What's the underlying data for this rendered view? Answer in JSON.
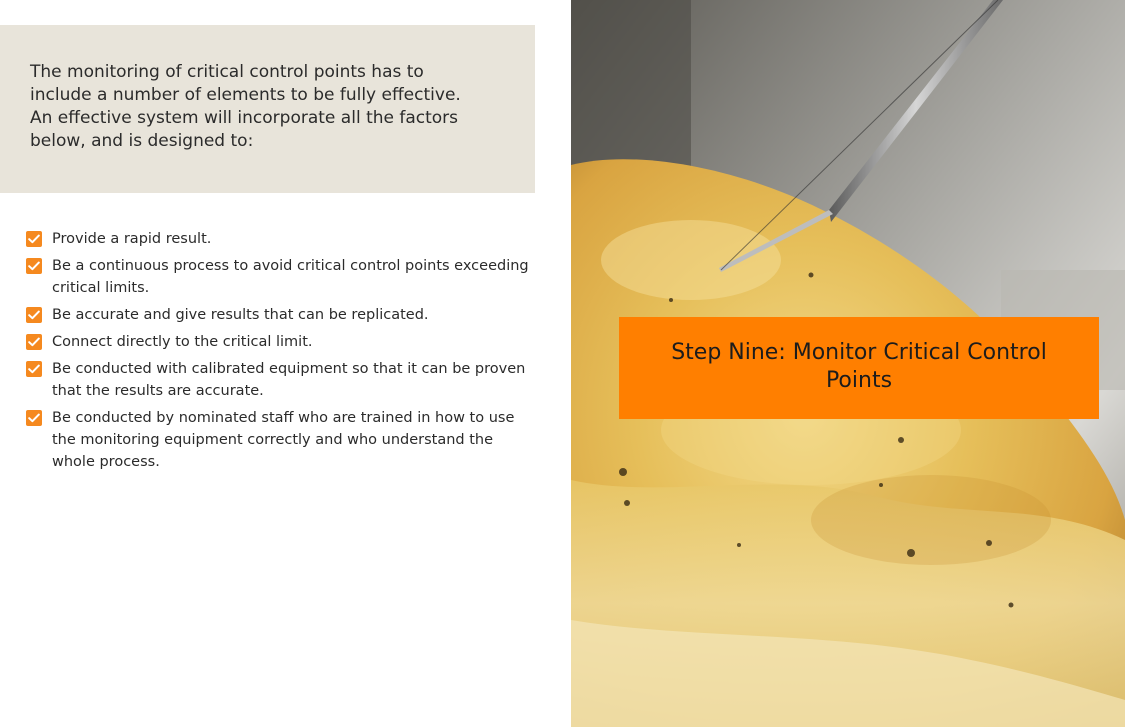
{
  "intro": {
    "text": "The monitoring of critical control points has to include a number of elements to be fully effective. An effective system will incorporate all the factors below, and is designed to:"
  },
  "checklist": {
    "icon": "checkbox-checked-icon",
    "accent_color": "#f5891f",
    "items": [
      "Provide a rapid result.",
      "Be a continuous process to avoid critical control points exceeding critical limits.",
      "Be accurate and give results that can be replicated.",
      "Connect directly to the critical limit.",
      "Be conducted with calibrated equipment so that it can be proven that the results are accurate.",
      "Be conducted by nominated staff who are trained in how to use the monitoring equipment correctly and who understand the whole process."
    ]
  },
  "banner": {
    "title": "Step Nine: Monitor Critical Control Points",
    "background_color": "#ff7f00"
  },
  "colors": {
    "intro_background": "#e8e4da",
    "text": "#2b2b2b"
  }
}
